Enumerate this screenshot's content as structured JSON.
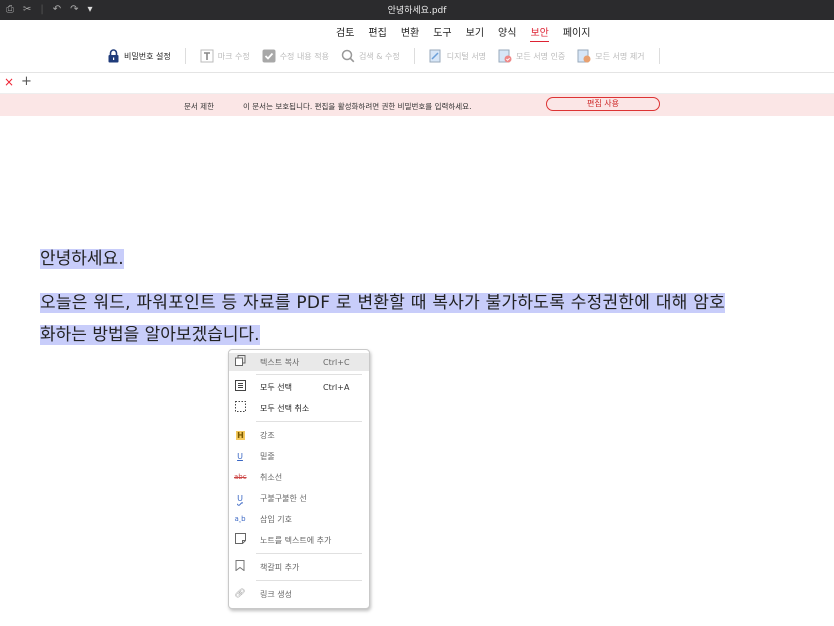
{
  "window": {
    "title": "안녕하세요.pdf"
  },
  "quick_access": [
    "print-icon",
    "scissors-icon",
    "undo-icon",
    "redo-icon",
    "dropdown-icon"
  ],
  "menu": {
    "items": [
      "검토",
      "편집",
      "변환",
      "도구",
      "보기",
      "양식",
      "보안",
      "페이지"
    ],
    "active": "보안"
  },
  "toolbar": {
    "password": "비밀번호 설정",
    "mark_edit": "마크 수정",
    "apply_edit": "수정 내용 적용",
    "search_edit": "검색 & 수정",
    "digital_sign": "디지털 서명",
    "verify_all": "모든 서명 인증",
    "remove_all": "모든 서명 제거"
  },
  "tabbar": {
    "close": "×",
    "add": "+"
  },
  "notice": {
    "title": "문서 제한",
    "message": "이 문서는 보호됩니다. 편집을 활성화하려면 권한 비밀번호를 입력하세요.",
    "button": "편집 사용"
  },
  "document": {
    "line1": "안녕하세요.",
    "line2": "오늘은 워드, 파워포인트 등 자료를 PDF 로 변환할 때 복사가 불가하도록 수정권한에 대해 암호",
    "line3": "화하는 방법을 알아보겠습니다."
  },
  "context_menu": {
    "copy": {
      "label": "텍스트 복사",
      "shortcut": "Ctrl+C"
    },
    "select_all": {
      "label": "모두 선택",
      "shortcut": "Ctrl+A"
    },
    "deselect_all": {
      "label": "모두 선택 취소"
    },
    "highlight": {
      "label": "강조"
    },
    "underline": {
      "label": "밑줄"
    },
    "strikethrough": {
      "label": "취소선"
    },
    "squiggly": {
      "label": "구불구불한 선"
    },
    "insert_mark": {
      "label": "삽입 기호"
    },
    "add_note": {
      "label": "노트를 텍스트에 추가"
    },
    "bookmark": {
      "label": "책갈피 추가"
    },
    "create_link": {
      "label": "링크 생성"
    }
  },
  "colors": {
    "accent": "#d22233",
    "selection": "#c8cdfa",
    "notice_bg": "#fbe6e6",
    "titlebar": "#2b2b2d"
  }
}
